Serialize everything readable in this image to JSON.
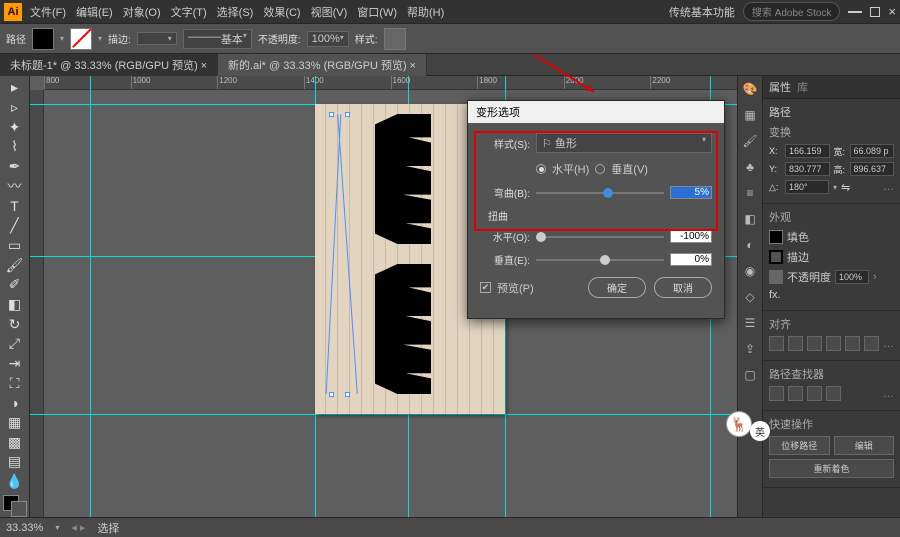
{
  "app": {
    "logo": "Ai"
  },
  "menu": [
    "文件(F)",
    "编辑(E)",
    "对象(O)",
    "文字(T)",
    "选择(S)",
    "效果(C)",
    "视图(V)",
    "窗口(W)",
    "帮助(H)"
  ],
  "workspaceLabel": "传统基本功能",
  "searchPlaceholder": "搜索 Adobe Stock",
  "options": {
    "pathLbl": "路径",
    "strokeLbl": "描边:",
    "strokeVal": "",
    "basicLbl": "基本",
    "opacityLbl": "不透明度:",
    "opacityVal": "100%",
    "styleLbl": "样式:"
  },
  "tabs": [
    {
      "label": "未标题-1* @ 33.33% (RGB/GPU 预览)",
      "active": true
    },
    {
      "label": "新的.ai* @ 33.33% (RGB/GPU 预览)",
      "active": false
    }
  ],
  "rulerMarks": [
    "800",
    "1000",
    "1200",
    "1400",
    "1600",
    "1800",
    "2000",
    "2200"
  ],
  "dialog": {
    "title": "变形选项",
    "styleLbl": "样式(S):",
    "styleVal": "鱼形",
    "horizLbl": "水平(H)",
    "vertLbl": "垂直(V)",
    "bendLbl": "弯曲(B):",
    "bendVal": "5%",
    "distortLbl": "扭曲",
    "hDistLbl": "水平(O):",
    "hDistVal": "-100%",
    "vDistLbl": "垂直(E):",
    "vDistVal": "0%",
    "previewLbl": "预览(P)",
    "okLbl": "确定",
    "cancelLbl": "取消"
  },
  "panels": {
    "propsTitle": "属性",
    "libTitle": "库",
    "objType": "路径",
    "transformTitle": "变换",
    "x": "166.159",
    "w": "66.089 p",
    "y": "830.777",
    "h": "896.637",
    "rotLbl": "△:",
    "rot": "180°",
    "appearTitle": "外观",
    "fillLbl": "填色",
    "strokeLbl": "描边",
    "opLbl": "不透明度",
    "opVal": "100%",
    "fxLbl": "fx.",
    "alignTitle": "对齐",
    "pathfindTitle": "路径查找器",
    "quickTitle": "快速操作",
    "offsetBtn": "位移路径",
    "editBtn": "编辑",
    "recolorBtn": "重新着色"
  },
  "status": {
    "zoom": "33.33%",
    "tool": "选择"
  },
  "watermarkBadge": "英"
}
